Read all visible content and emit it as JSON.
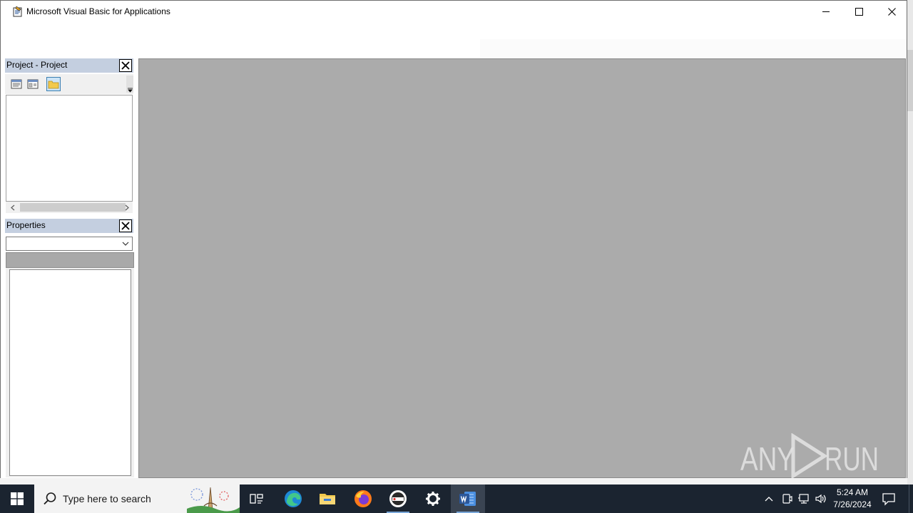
{
  "window": {
    "title": "Microsoft Visual Basic for Applications"
  },
  "project_pane": {
    "title": "Project - Project",
    "toolbar": [
      "view-code-icon",
      "view-object-icon",
      "toggle-folders-icon"
    ]
  },
  "properties_pane": {
    "title": "Properties",
    "selected_object": ""
  },
  "taskbar": {
    "search_placeholder": "Type here to search",
    "apps": [
      "task-view-icon",
      "edge-icon",
      "file-explorer-icon",
      "firefox-icon",
      "anyrun-app-icon",
      "settings-icon",
      "word-icon"
    ],
    "time": "5:24 AM",
    "date": "7/26/2024"
  },
  "watermark": {
    "text": "ANY RUN"
  },
  "colors": {
    "pane_title_bg": "#c4cfe0",
    "mdi_bg": "#ababab",
    "taskbar_bg": "#1b2430",
    "word_blue": "#2b579a"
  }
}
